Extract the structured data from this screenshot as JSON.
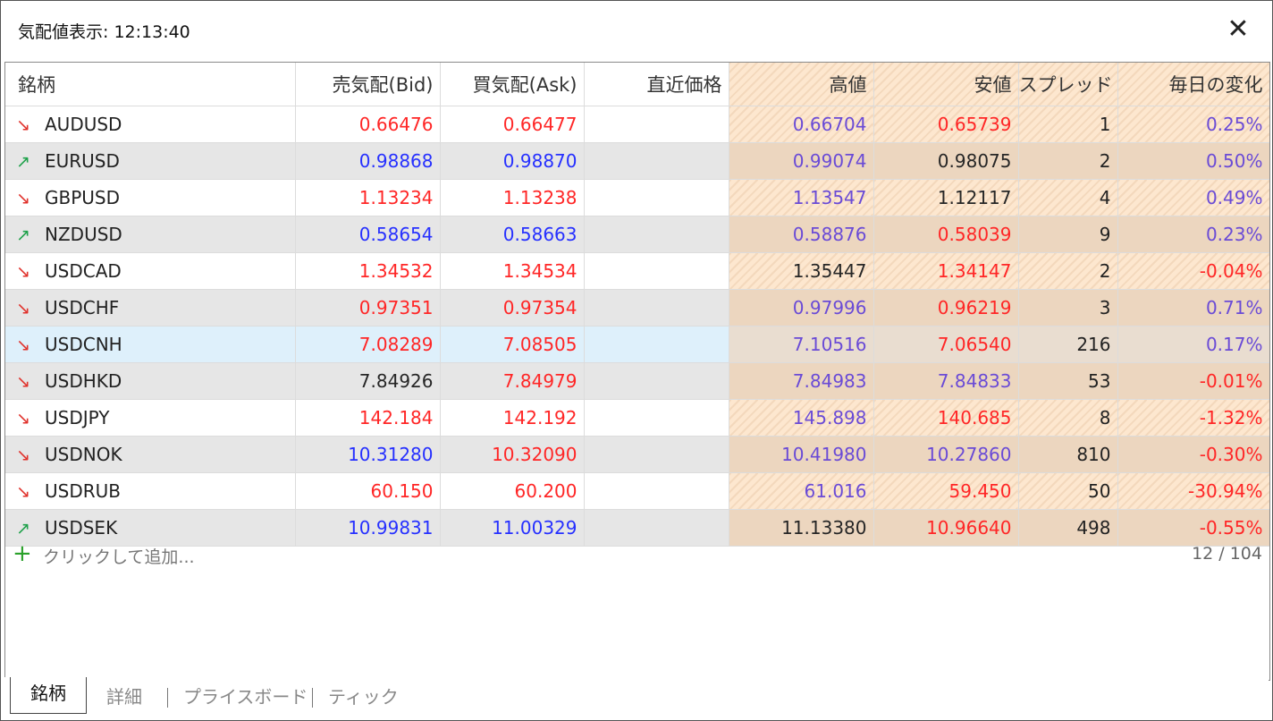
{
  "window": {
    "title": "気配値表示: 12:13:40",
    "close_label": "✕"
  },
  "columns": [
    "銘柄",
    "売気配(Bid)",
    "買気配(Ask)",
    "直近価格",
    "高値",
    "安値",
    "スプレッド",
    "毎日の変化"
  ],
  "colors": {
    "bid_ask_down": "#ff2626",
    "bid_ask_up": "#2630ff",
    "high_color": "#6a4bd6",
    "neutral": "#262626",
    "arrow_up": "#1ea14a",
    "arrow_down": "#e0302a",
    "highlight_bg": "#fde7cf",
    "selected_row_bg": "#def0fb"
  },
  "rows": [
    {
      "dir": "down",
      "symbol": "AUDUSD",
      "bid": "0.66476",
      "ask": "0.66477",
      "last": "",
      "high": "0.66704",
      "low": "0.65739",
      "spread": "1",
      "change": "0.25%",
      "bid_c": "red",
      "ask_c": "red",
      "high_c": "purple",
      "low_c": "red",
      "change_c": "purple"
    },
    {
      "dir": "up",
      "symbol": "EURUSD",
      "bid": "0.98868",
      "ask": "0.98870",
      "last": "",
      "high": "0.99074",
      "low": "0.98075",
      "spread": "2",
      "change": "0.50%",
      "bid_c": "blue",
      "ask_c": "blue",
      "high_c": "purple",
      "low_c": "black",
      "change_c": "purple"
    },
    {
      "dir": "down",
      "symbol": "GBPUSD",
      "bid": "1.13234",
      "ask": "1.13238",
      "last": "",
      "high": "1.13547",
      "low": "1.12117",
      "spread": "4",
      "change": "0.49%",
      "bid_c": "red",
      "ask_c": "red",
      "high_c": "purple",
      "low_c": "black",
      "change_c": "purple"
    },
    {
      "dir": "up",
      "symbol": "NZDUSD",
      "bid": "0.58654",
      "ask": "0.58663",
      "last": "",
      "high": "0.58876",
      "low": "0.58039",
      "spread": "9",
      "change": "0.23%",
      "bid_c": "blue",
      "ask_c": "blue",
      "high_c": "purple",
      "low_c": "red",
      "change_c": "purple"
    },
    {
      "dir": "down",
      "symbol": "USDCAD",
      "bid": "1.34532",
      "ask": "1.34534",
      "last": "",
      "high": "1.35447",
      "low": "1.34147",
      "spread": "2",
      "change": "-0.04%",
      "bid_c": "red",
      "ask_c": "red",
      "high_c": "black",
      "low_c": "red",
      "change_c": "red"
    },
    {
      "dir": "down",
      "symbol": "USDCHF",
      "bid": "0.97351",
      "ask": "0.97354",
      "last": "",
      "high": "0.97996",
      "low": "0.96219",
      "spread": "3",
      "change": "0.71%",
      "bid_c": "red",
      "ask_c": "red",
      "high_c": "purple",
      "low_c": "red",
      "change_c": "purple"
    },
    {
      "dir": "down",
      "symbol": "USDCNH",
      "bid": "7.08289",
      "ask": "7.08505",
      "last": "",
      "high": "7.10516",
      "low": "7.06540",
      "spread": "216",
      "change": "0.17%",
      "bid_c": "red",
      "ask_c": "red",
      "high_c": "purple",
      "low_c": "red",
      "change_c": "purple",
      "selected": true
    },
    {
      "dir": "down",
      "symbol": "USDHKD",
      "bid": "7.84926",
      "ask": "7.84979",
      "last": "",
      "high": "7.84983",
      "low": "7.84833",
      "spread": "53",
      "change": "-0.01%",
      "bid_c": "black",
      "ask_c": "red",
      "high_c": "purple",
      "low_c": "purple",
      "change_c": "red"
    },
    {
      "dir": "down",
      "symbol": "USDJPY",
      "bid": "142.184",
      "ask": "142.192",
      "last": "",
      "high": "145.898",
      "low": "140.685",
      "spread": "8",
      "change": "-1.32%",
      "bid_c": "red",
      "ask_c": "red",
      "high_c": "purple",
      "low_c": "red",
      "change_c": "red"
    },
    {
      "dir": "down",
      "symbol": "USDNOK",
      "bid": "10.31280",
      "ask": "10.32090",
      "last": "",
      "high": "10.41980",
      "low": "10.27860",
      "spread": "810",
      "change": "-0.30%",
      "bid_c": "blue",
      "ask_c": "red",
      "high_c": "purple",
      "low_c": "purple",
      "change_c": "red"
    },
    {
      "dir": "down",
      "symbol": "USDRUB",
      "bid": "60.150",
      "ask": "60.200",
      "last": "",
      "high": "61.016",
      "low": "59.450",
      "spread": "50",
      "change": "-30.94%",
      "bid_c": "red",
      "ask_c": "red",
      "high_c": "purple",
      "low_c": "red",
      "change_c": "red"
    },
    {
      "dir": "up",
      "symbol": "USDSEK",
      "bid": "10.99831",
      "ask": "11.00329",
      "last": "",
      "high": "11.13380",
      "low": "10.96640",
      "spread": "498",
      "change": "-0.55%",
      "bid_c": "blue",
      "ask_c": "blue",
      "high_c": "black",
      "low_c": "red",
      "change_c": "red"
    }
  ],
  "arrow_icons": {
    "up": "↗",
    "down": "↘"
  },
  "add_row": {
    "icon": "+",
    "label": "クリックして追加...",
    "count": "12 / 104"
  },
  "tabs": [
    {
      "label": "銘柄",
      "active": true
    },
    {
      "label": "詳細",
      "active": false
    },
    {
      "label": "プライスボード",
      "active": false
    },
    {
      "label": "ティック",
      "active": false
    }
  ]
}
